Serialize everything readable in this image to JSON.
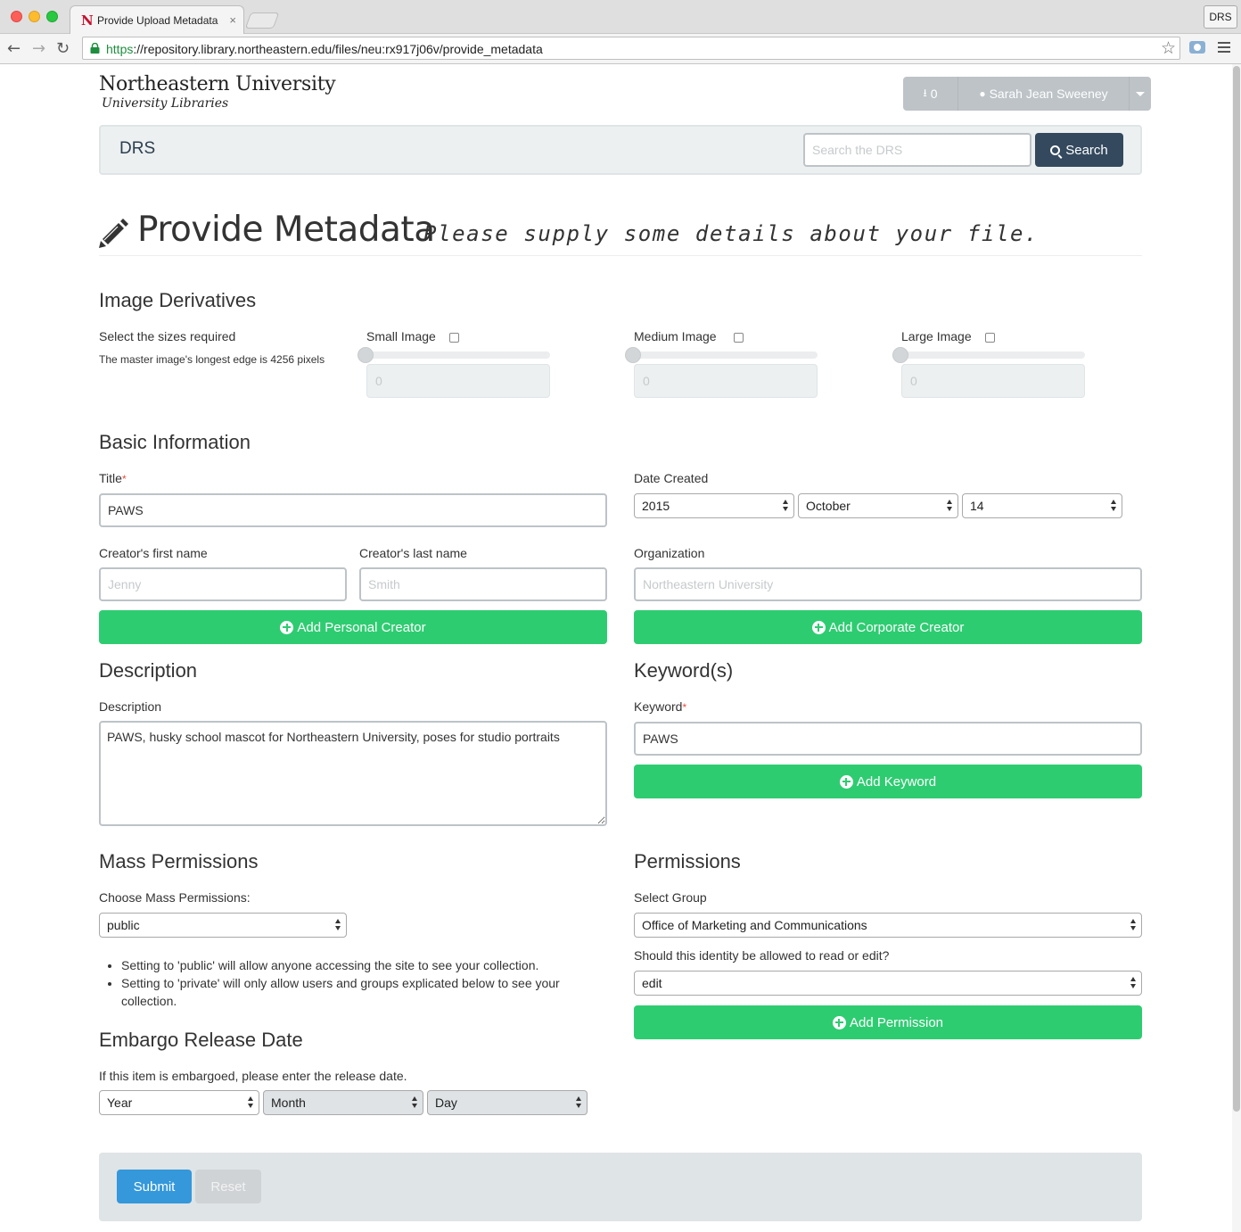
{
  "browser": {
    "tab_title": "Provide Upload Metadata",
    "tab_close": "×",
    "profile_label": "DRS",
    "url_scheme": "https",
    "url_rest": "://repository.library.northeastern.edu/files/neu:rx917j06v/provide_metadata",
    "favicon": "N",
    "icons": [
      "back-arrow-icon",
      "forward-arrow-icon",
      "reload-icon",
      "lock-icon",
      "star-icon",
      "camera-icon",
      "menu-icon"
    ]
  },
  "header": {
    "logo_main": "Northeastern University",
    "logo_sub": "University Libraries",
    "downloads_count": "0",
    "user_name": "Sarah Jean Sweeney"
  },
  "navbar": {
    "brand": "DRS",
    "search_placeholder": "Search the DRS",
    "search_label": "Search"
  },
  "page_header": {
    "title": "Provide Metadata",
    "subtitle": "Please supply some details about your file."
  },
  "image_derivatives": {
    "heading": "Image Derivatives",
    "select_label": "Select the sizes required",
    "note": "The master image's longest edge is 4256 pixels",
    "sizes": [
      {
        "label": "Small Image",
        "checked": false,
        "value": "0"
      },
      {
        "label": "Medium Image",
        "checked": false,
        "value": "0"
      },
      {
        "label": "Large Image",
        "checked": false,
        "value": "0"
      }
    ]
  },
  "basic_info": {
    "heading": "Basic Information",
    "title_label": "Title",
    "required_mark": "*",
    "title_value": "PAWS",
    "date_label": "Date Created",
    "date_year": "2015",
    "date_month": "October",
    "date_day": "14",
    "first_name_label": "Creator's first name",
    "first_name_placeholder": "Jenny",
    "last_name_label": "Creator's last name",
    "last_name_placeholder": "Smith",
    "org_label": "Organization",
    "org_placeholder": "Northeastern University",
    "add_personal": "Add Personal Creator",
    "add_corporate": "Add Corporate Creator"
  },
  "description": {
    "heading": "Description",
    "label": "Description",
    "value": "PAWS, husky school mascot for Northeastern University, poses for studio portraits"
  },
  "keywords": {
    "heading": "Keyword(s)",
    "label": "Keyword",
    "value": "PAWS",
    "add_label": "Add Keyword"
  },
  "mass_permissions": {
    "heading": "Mass Permissions",
    "label": "Choose Mass Permissions:",
    "value": "public",
    "bullets": [
      "Setting to 'public' will allow anyone accessing the site to see your collection.",
      "Setting to 'private' will only allow users and groups explicated below to see your collection."
    ]
  },
  "permissions": {
    "heading": "Permissions",
    "group_label": "Select Group",
    "group_value": "Office of Marketing and Communications",
    "access_label": "Should this identity be allowed to read or edit?",
    "access_value": "edit",
    "add_label": "Add Permission"
  },
  "embargo": {
    "heading": "Embargo Release Date",
    "label": "If this item is embargoed, please enter the release date.",
    "year": "Year",
    "month": "Month",
    "day": "Day"
  },
  "actions": {
    "submit": "Submit",
    "reset": "Reset"
  },
  "colors": {
    "green_button": "#2ecc71",
    "submit_blue": "#3498db",
    "navbar_bg": "#ecf0f1",
    "search_button": "#34495e",
    "required_red": "#e74c3c"
  }
}
